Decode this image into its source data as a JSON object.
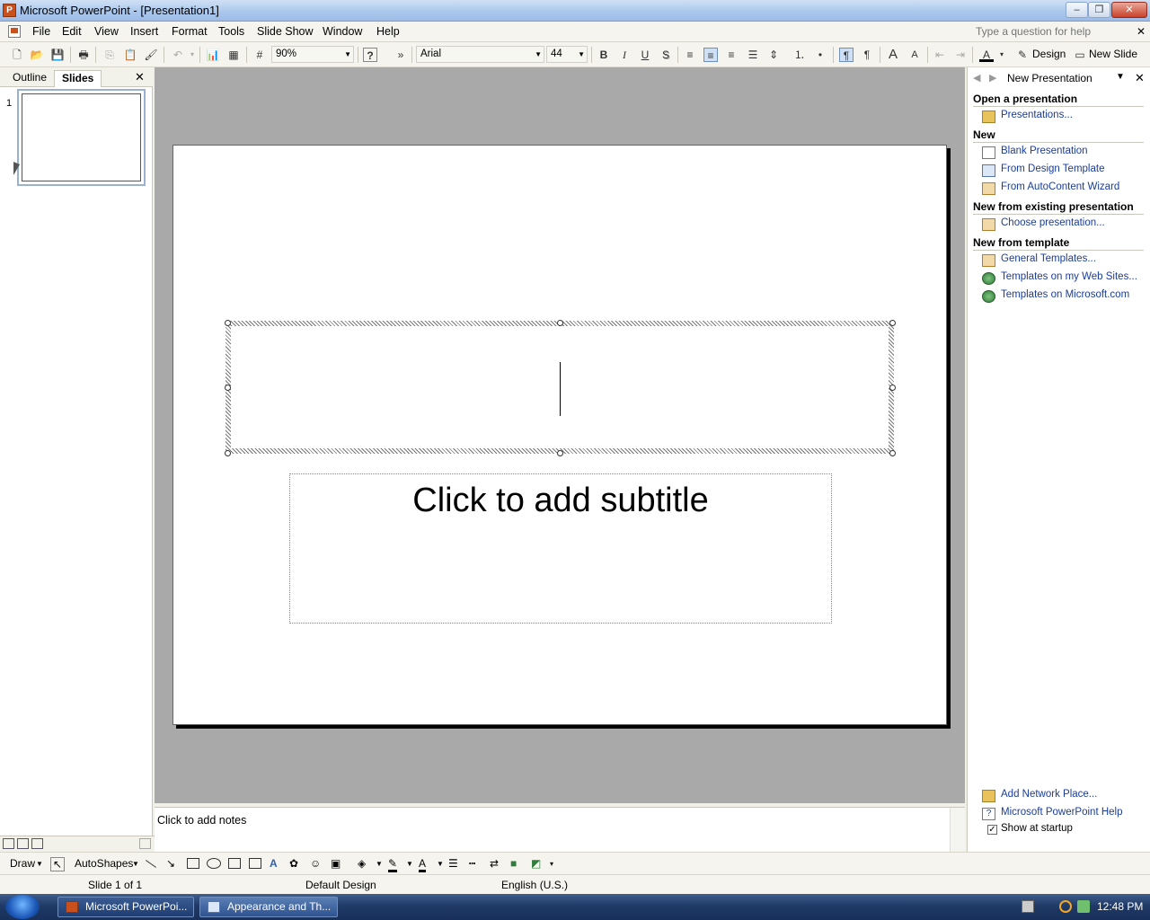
{
  "window": {
    "title": "Microsoft PowerPoint - [Presentation1]",
    "min": "–",
    "restore": "❐",
    "close": "✕"
  },
  "menu": {
    "items": [
      "File",
      "Edit",
      "View",
      "Insert",
      "Format",
      "Tools",
      "Slide Show",
      "Window",
      "Help"
    ],
    "help_placeholder": "Type a question for help",
    "close": "✕"
  },
  "toolbar": {
    "zoom": "90%",
    "font": "Arial",
    "font_size": "44",
    "bold": "B",
    "italic": "I",
    "underline": "U",
    "shadow": "S",
    "more": "»",
    "design_label": "Design",
    "new_slide_label": "New Slide"
  },
  "left_pane": {
    "tabs": [
      "Outline",
      "Slides"
    ],
    "active_tab": "Slides",
    "close": "✕",
    "slide_number": "1"
  },
  "slide": {
    "subtitle_placeholder": "Click to add subtitle"
  },
  "notes": {
    "placeholder": "Click to add notes"
  },
  "task_pane": {
    "title": "New Presentation",
    "back": "◀",
    "forward": "▶",
    "dropdown": "▼",
    "close": "✕",
    "sections": {
      "open": {
        "heading": "Open a presentation",
        "links": [
          "Presentations..."
        ]
      },
      "new": {
        "heading": "New",
        "links": [
          "Blank Presentation",
          "From Design Template",
          "From AutoContent Wizard"
        ]
      },
      "existing": {
        "heading": "New from existing presentation",
        "links": [
          "Choose presentation..."
        ]
      },
      "template": {
        "heading": "New from template",
        "links": [
          "General Templates...",
          "Templates on my Web Sites...",
          "Templates on Microsoft.com"
        ]
      }
    },
    "footer": {
      "links": [
        "Add Network Place...",
        "Microsoft PowerPoint Help"
      ],
      "show_at_startup": "Show at startup",
      "show_at_startup_checked": "✓"
    }
  },
  "draw_toolbar": {
    "draw_label": "Draw",
    "autoshapes_label": "AutoShapes"
  },
  "status": {
    "slide": "Slide 1 of 1",
    "design": "Default Design",
    "language": "English (U.S.)"
  },
  "taskbar": {
    "tasks": [
      "Microsoft PowerPoi...",
      "Appearance and Th..."
    ],
    "time": "12:48 PM"
  },
  "colors": {
    "link": "#1a3d9c",
    "canvas_bg": "#a9a9a9",
    "taskbar": "#1f3a66"
  }
}
